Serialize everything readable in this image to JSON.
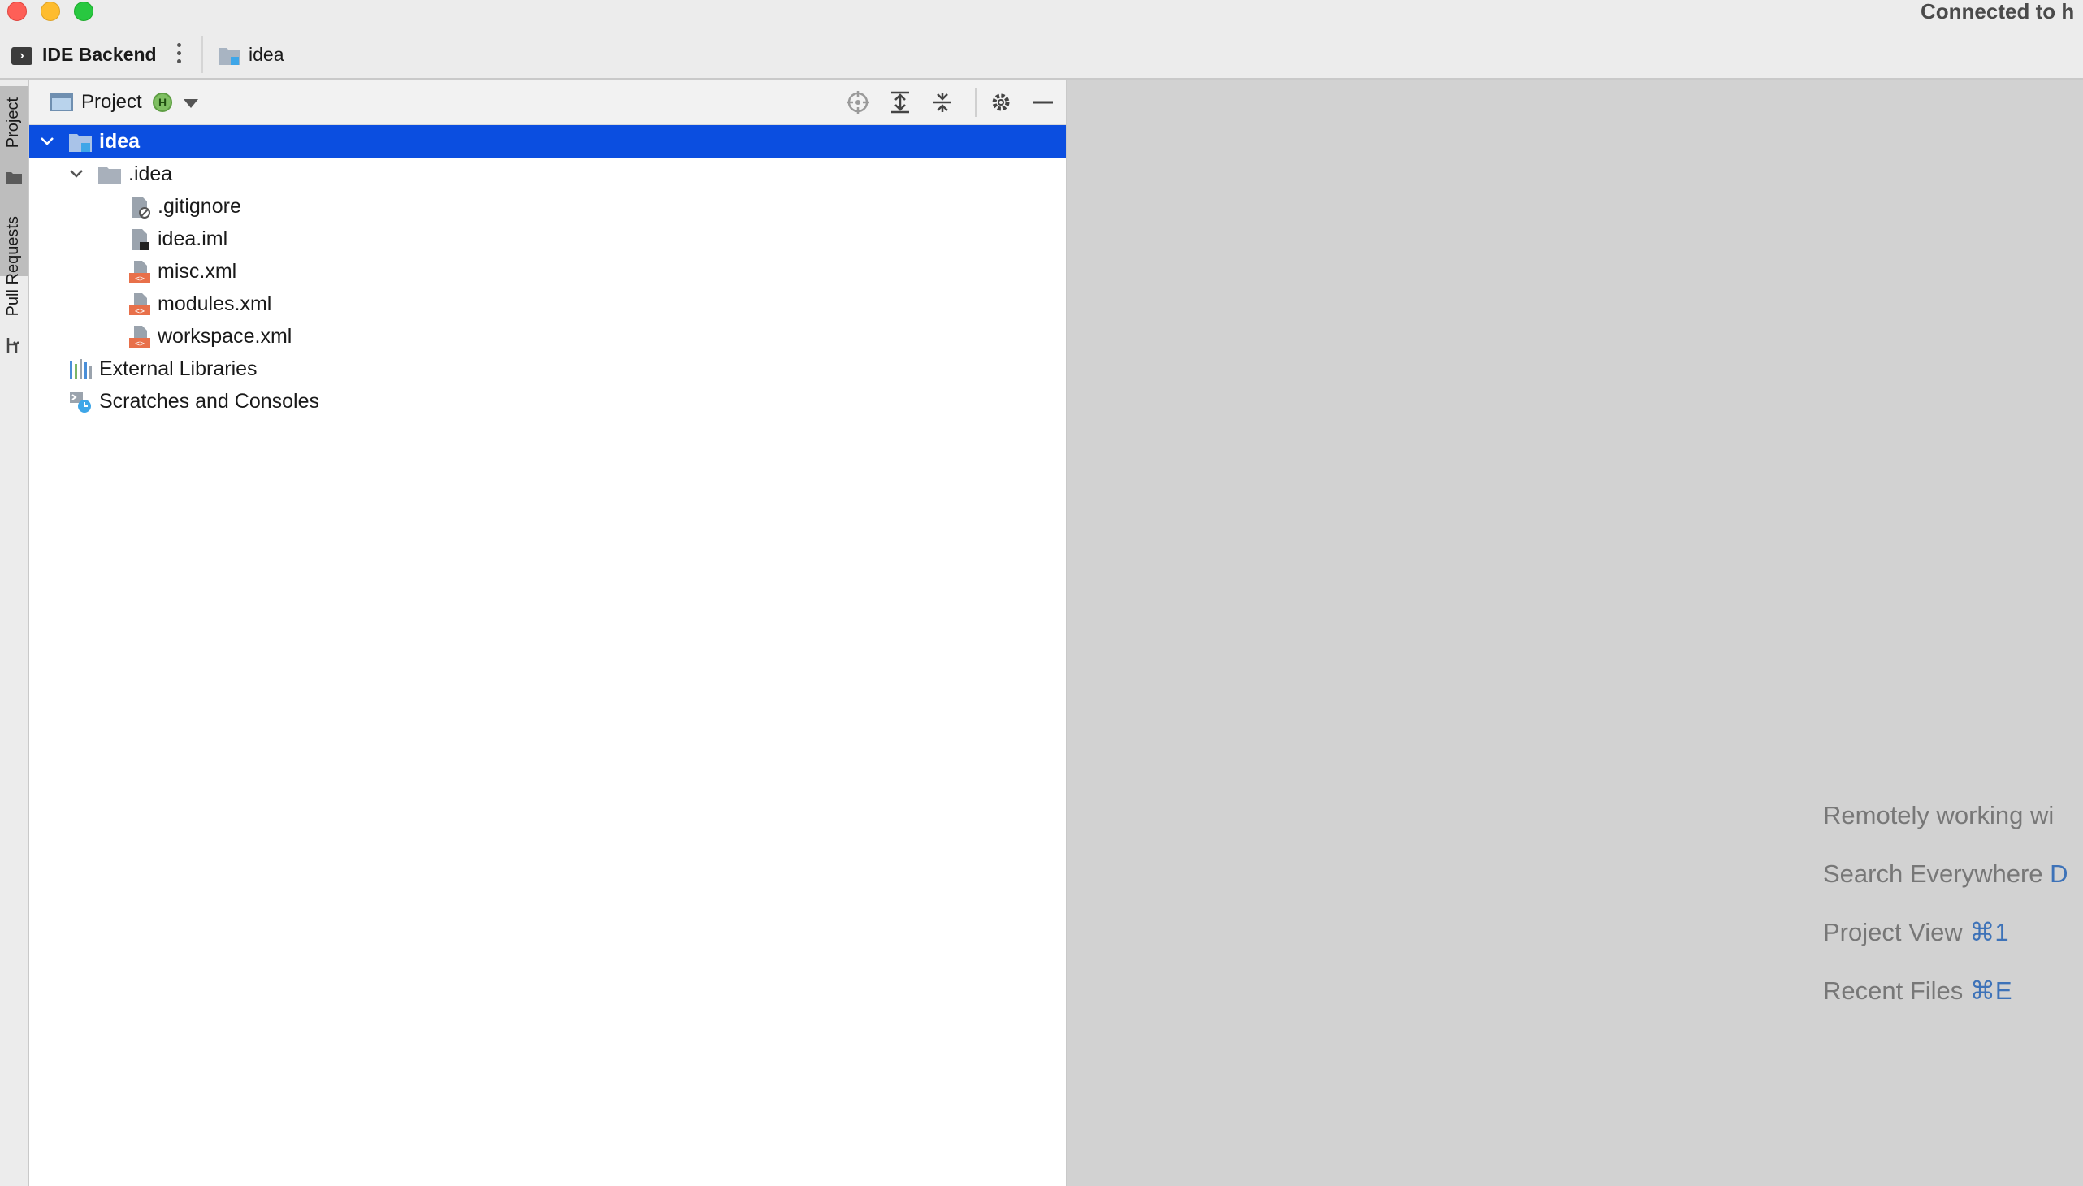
{
  "window": {
    "title": "Connected to h"
  },
  "toolbar": {
    "backend_label": "IDE Backend",
    "project_name": "idea"
  },
  "left_strip": {
    "project_tab": "Project",
    "pull_requests_tab": "Pull Requests"
  },
  "project_panel": {
    "title": "Project",
    "badge": "H"
  },
  "tree": {
    "root": "idea",
    "idea_folder": ".idea",
    "files": [
      ".gitignore",
      "idea.iml",
      "misc.xml",
      "modules.xml",
      "workspace.xml"
    ],
    "external_libraries": "External Libraries",
    "scratches": "Scratches and Consoles"
  },
  "editor": {
    "hints": [
      {
        "text": "Remotely working wi",
        "key": ""
      },
      {
        "text": "Search Everywhere ",
        "key": "D"
      },
      {
        "text": "Project View ",
        "key": "⌘1"
      },
      {
        "text": "Recent Files ",
        "key": "⌘E"
      }
    ]
  },
  "colors": {
    "selection": "#0b4ee0",
    "hint_text": "#777777",
    "hint_key": "#3d72b8",
    "xml_icon": "#e8704a"
  }
}
